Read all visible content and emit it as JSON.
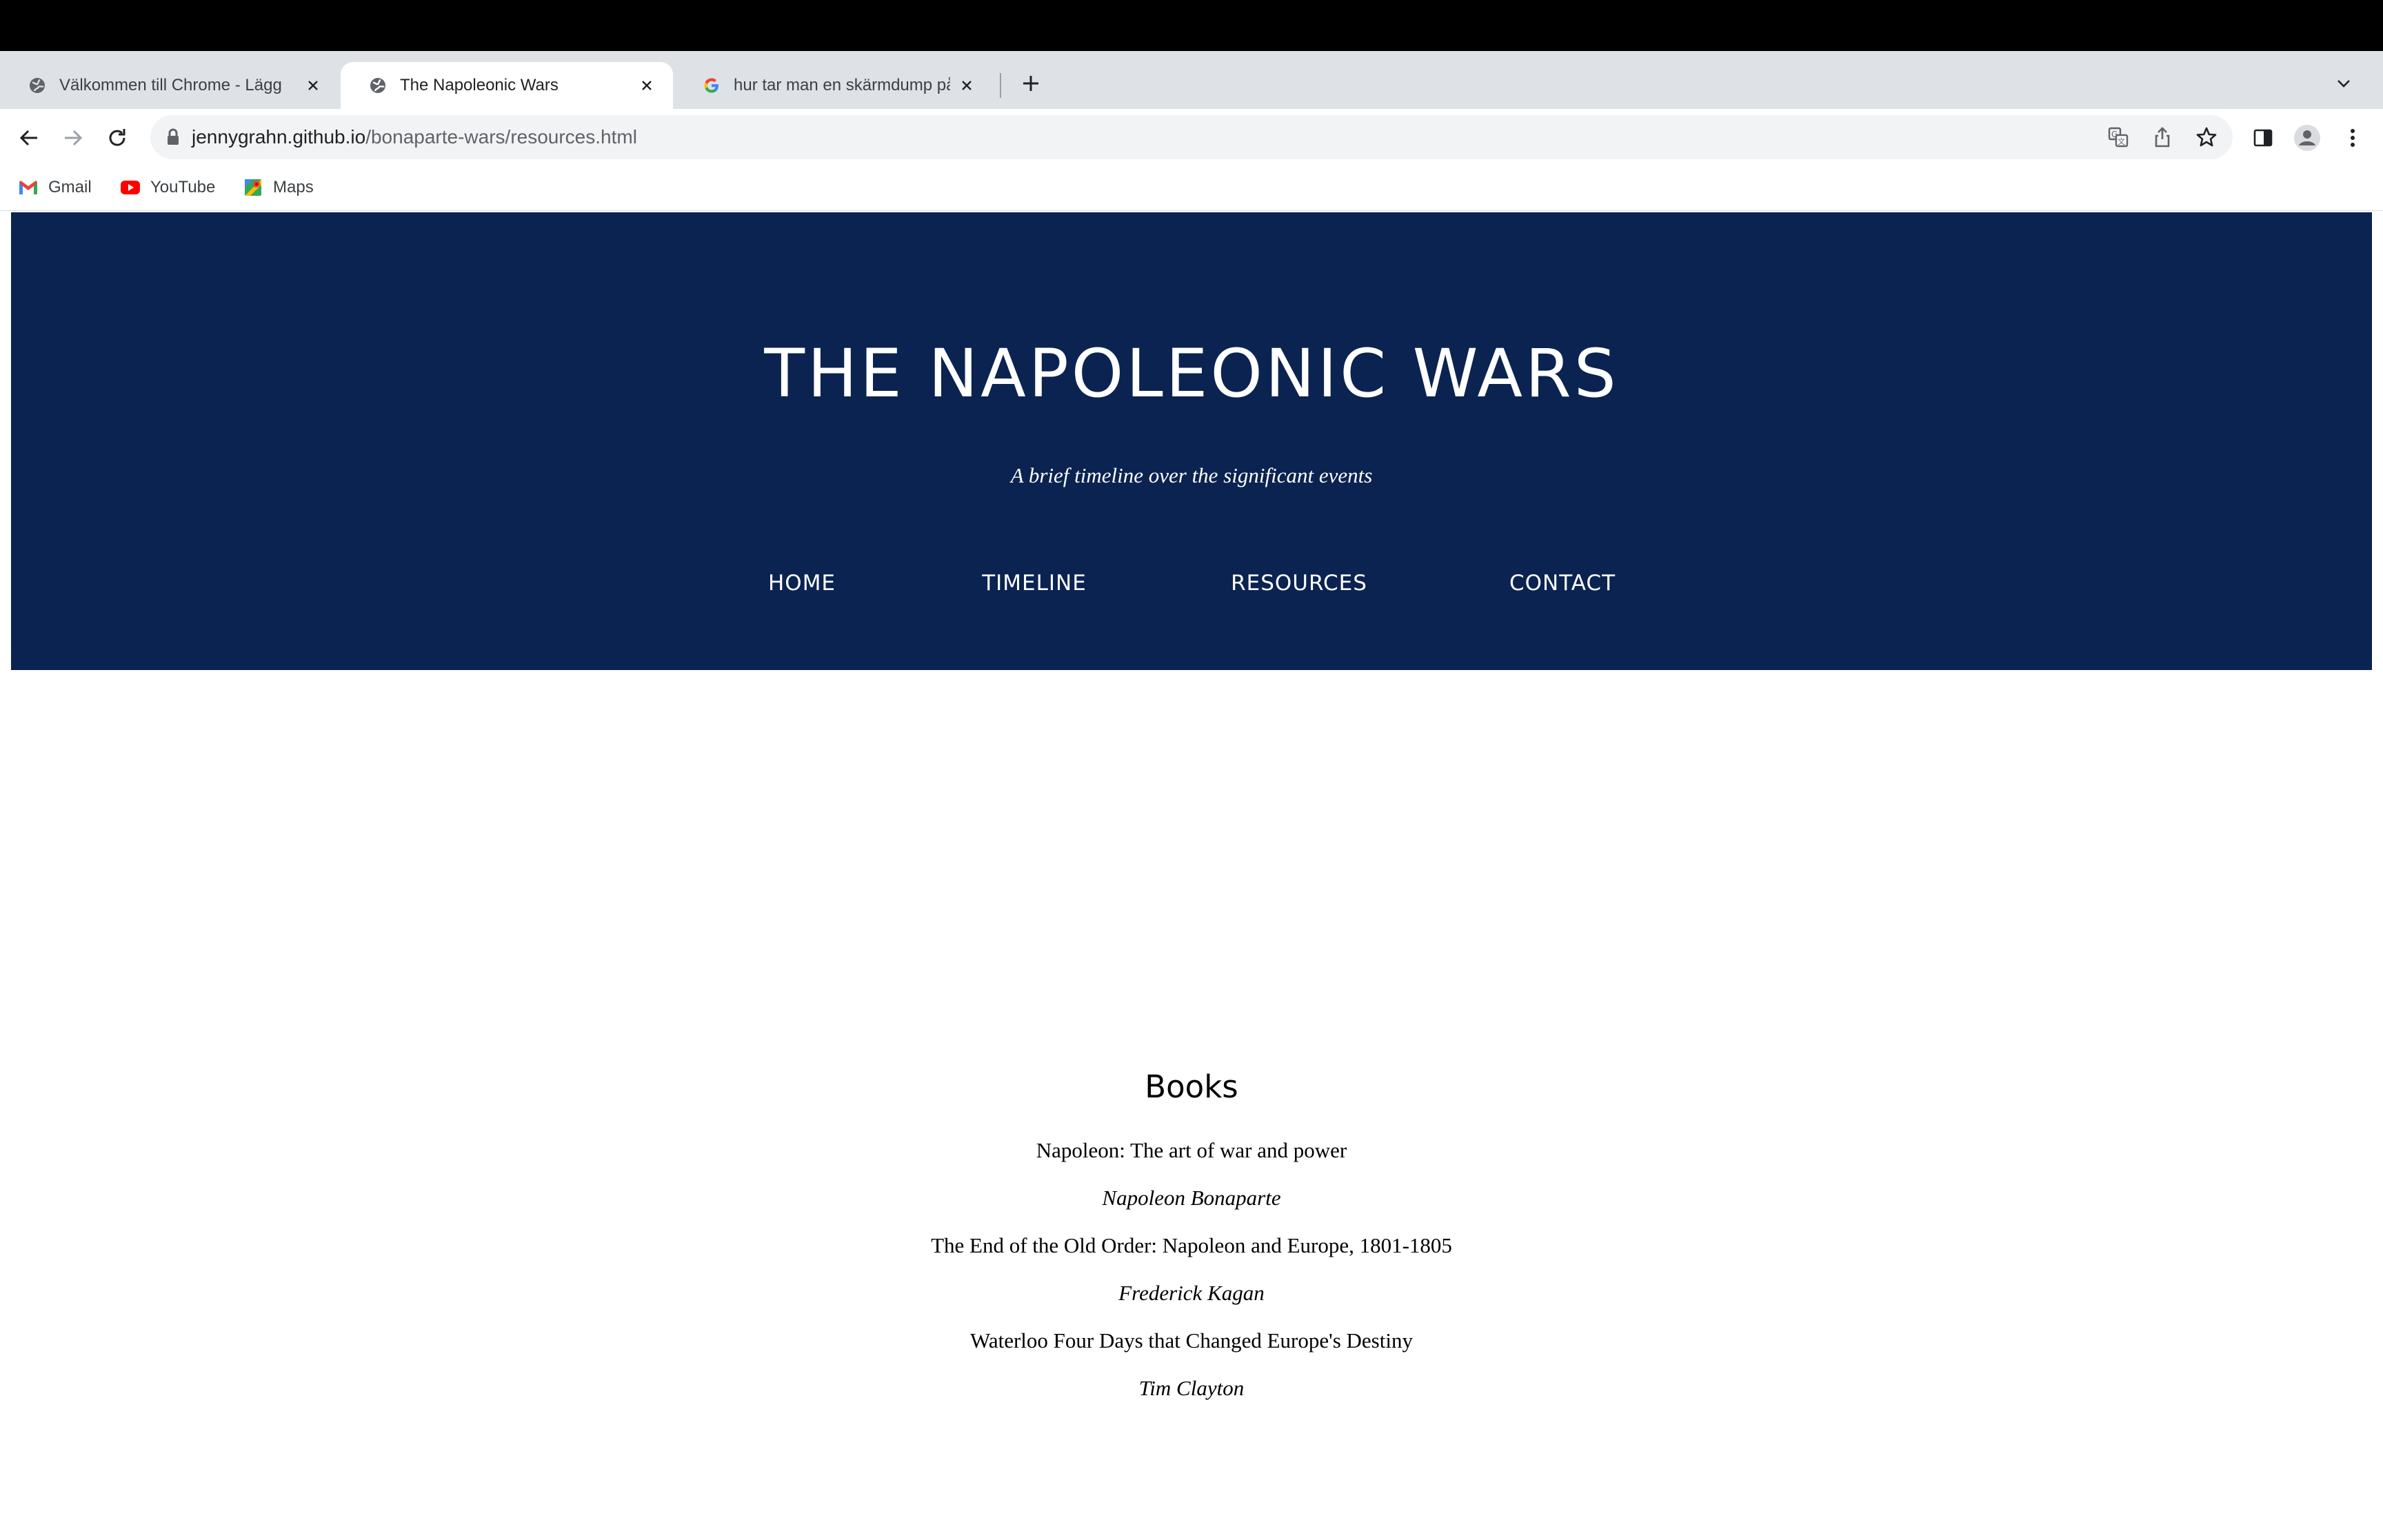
{
  "browser": {
    "tabs": [
      {
        "title": "Välkommen till Chrome - Lägg",
        "active": false,
        "favicon": "globe-icon"
      },
      {
        "title": "The Napoleonic Wars",
        "active": true,
        "favicon": "globe-icon"
      },
      {
        "title": "hur tar man en skärmdump på",
        "active": false,
        "favicon": "google-icon"
      }
    ],
    "url_host": "jennygrahn.github.io",
    "url_path": "/bonaparte-wars/resources.html",
    "bookmarks": [
      {
        "label": "Gmail",
        "icon": "gmail-icon"
      },
      {
        "label": "YouTube",
        "icon": "youtube-icon"
      },
      {
        "label": "Maps",
        "icon": "maps-icon"
      }
    ]
  },
  "site": {
    "title": "THE NAPOLEONIC WARS",
    "subtitle": "A brief timeline over the significant events",
    "nav": [
      "HOME",
      "TIMELINE",
      "RESOURCES",
      "CONTACT"
    ],
    "header_color": "#0b2350"
  },
  "books": {
    "heading": "Books",
    "items": [
      {
        "title": "Napoleon: The art of war and power",
        "author": "Napoleon Bonaparte"
      },
      {
        "title": "The End of the Old Order: Napoleon and Europe, 1801-1805",
        "author": "Frederick Kagan"
      },
      {
        "title": "Waterloo Four Days that Changed Europe's Destiny",
        "author": "Tim Clayton"
      }
    ]
  }
}
